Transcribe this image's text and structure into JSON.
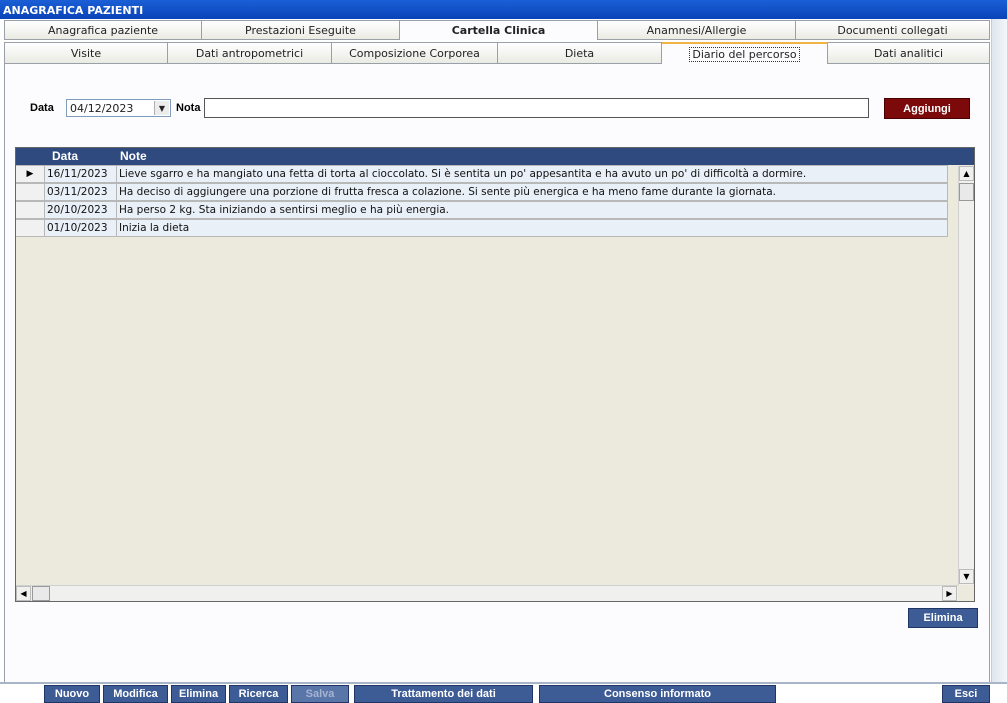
{
  "window": {
    "title": "ANAGRAFICA PAZIENTI"
  },
  "main_tabs": [
    {
      "label": "Anagrafica paziente"
    },
    {
      "label": "Prestazioni Eseguite"
    },
    {
      "label": "Cartella Clinica"
    },
    {
      "label": "Anamnesi/Allergie"
    },
    {
      "label": "Documenti collegati"
    }
  ],
  "sub_tabs": [
    {
      "label": "Visite"
    },
    {
      "label": "Dati antropometrici"
    },
    {
      "label": "Composizione Corporea"
    },
    {
      "label": "Dieta"
    },
    {
      "label": "Diario del percorso"
    },
    {
      "label": "Dati analitici"
    }
  ],
  "form": {
    "date_label": "Data",
    "date_value": "04/12/2023",
    "note_label": "Nota",
    "note_value": "",
    "add_button": "Aggiungi"
  },
  "grid": {
    "columns": [
      "Data",
      "Note"
    ],
    "rows": [
      {
        "date": "16/11/2023",
        "note": "Lieve sgarro e ha mangiato una fetta di torta al cioccolato. Si è sentita un po' appesantita e ha avuto un po' di difficoltà a dormire."
      },
      {
        "date": "03/11/2023",
        "note": "Ha deciso di aggiungere una porzione di frutta fresca a colazione. Si sente più energica e ha meno fame durante la giornata."
      },
      {
        "date": "20/10/2023",
        "note": "Ha perso 2 kg. Sta iniziando a sentirsi meglio e ha più energia."
      },
      {
        "date": "01/10/2023",
        "note": "Inizia la dieta"
      }
    ]
  },
  "delete_entry_button": "Elimina",
  "toolbar": {
    "nuovo": "Nuovo",
    "modifica": "Modifica",
    "elimina": "Elimina",
    "ricerca": "Ricerca",
    "salva": "Salva",
    "trattamento": "Trattamento dei dati",
    "consenso": "Consenso informato",
    "esci": "Esci"
  }
}
